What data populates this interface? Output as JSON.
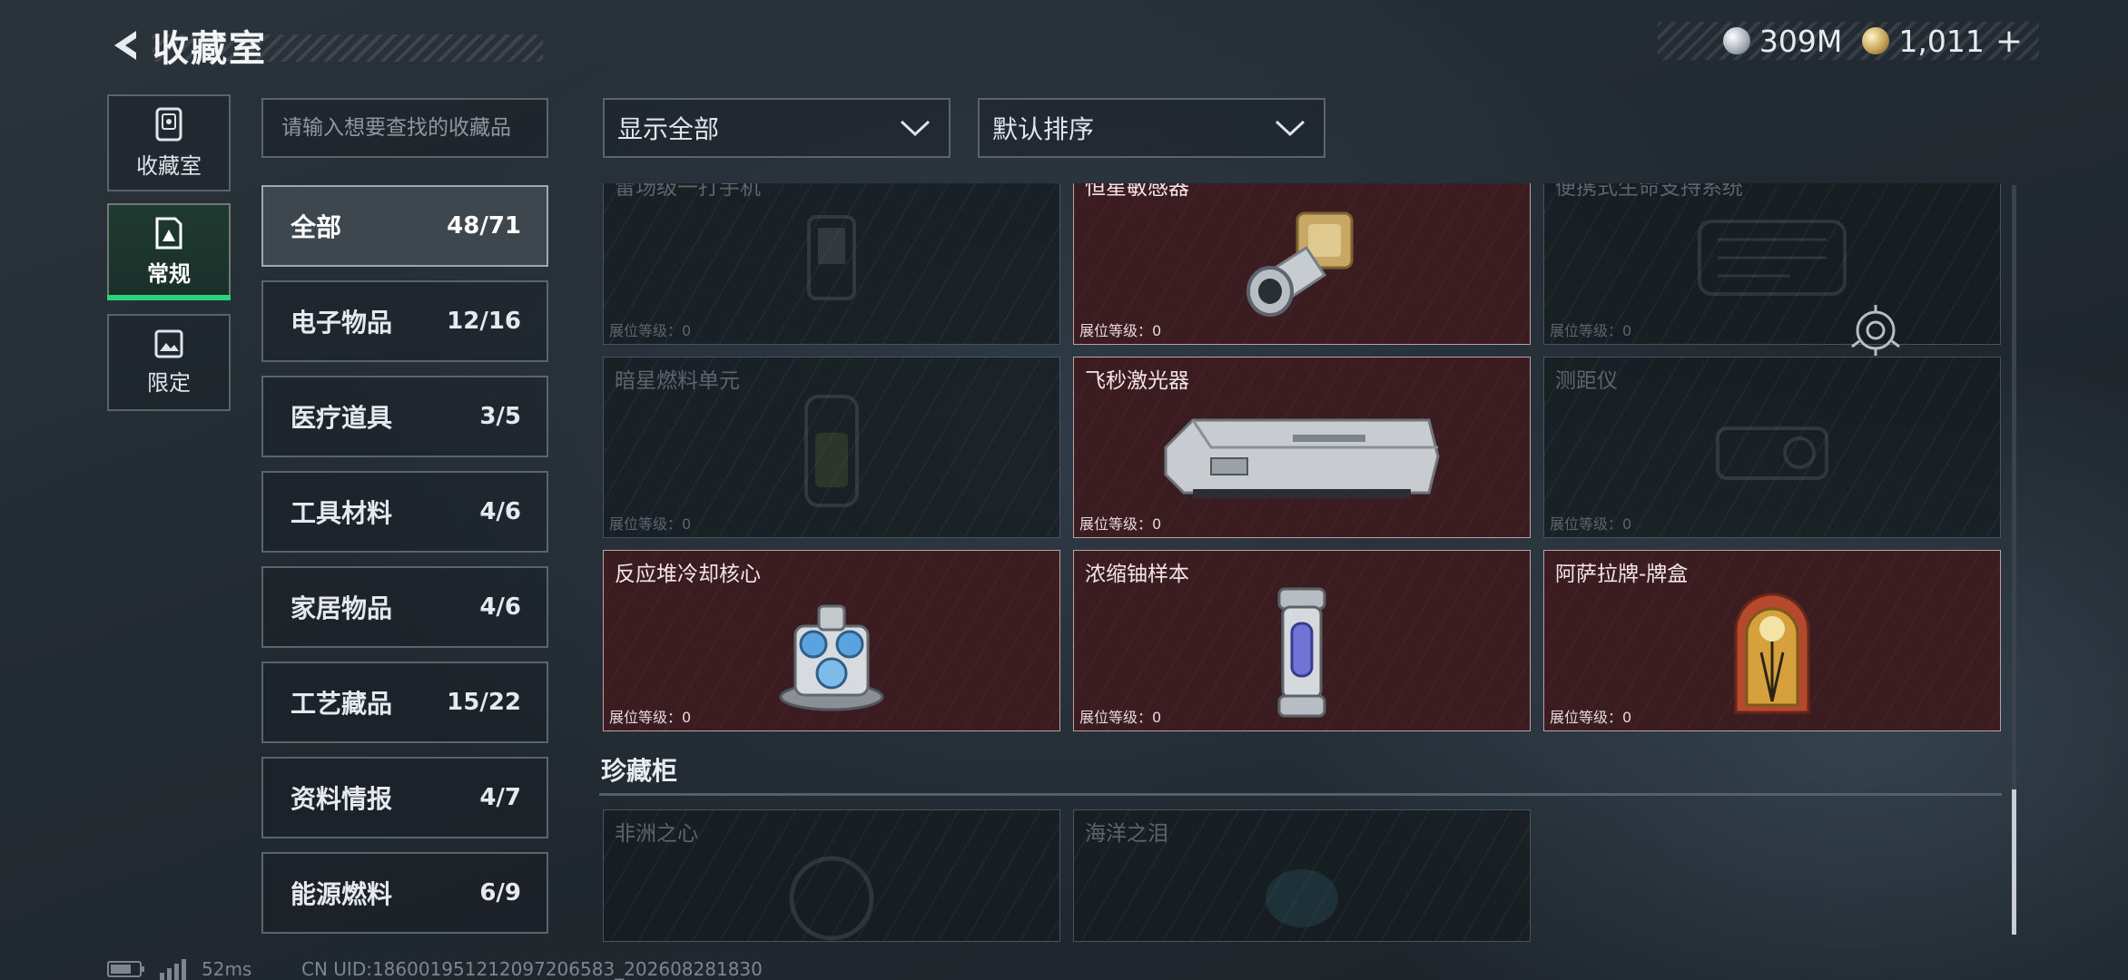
{
  "header": {
    "title": "收藏室"
  },
  "currency": {
    "silver": "309M",
    "gold": "1,011",
    "plus": "+"
  },
  "modes": [
    {
      "label": "收藏室",
      "icon": "vault-icon"
    },
    {
      "label": "常规",
      "icon": "card-icon"
    },
    {
      "label": "限定",
      "icon": "image-icon"
    }
  ],
  "search": {
    "placeholder": "请输入想要查找的收藏品"
  },
  "categories": [
    {
      "name": "全部",
      "count": "48/71"
    },
    {
      "name": "电子物品",
      "count": "12/16"
    },
    {
      "name": "医疗道具",
      "count": "3/5"
    },
    {
      "name": "工具材料",
      "count": "4/6"
    },
    {
      "name": "家居物品",
      "count": "4/6"
    },
    {
      "name": "工艺藏品",
      "count": "15/22"
    },
    {
      "name": "资料情报",
      "count": "4/7"
    },
    {
      "name": "能源燃料",
      "count": "6/9"
    }
  ],
  "filters": {
    "show": "显示全部",
    "sort": "默认排序"
  },
  "level_label": "展位等级：0",
  "items": [
    {
      "name": "雷场级一打手机",
      "owned": false
    },
    {
      "name": "恒星敏感器",
      "owned": true
    },
    {
      "name": "便携式生命支持系统",
      "owned": false
    },
    {
      "name": "暗星燃料单元",
      "owned": false
    },
    {
      "name": "飞秒激光器",
      "owned": true
    },
    {
      "name": "测距仪",
      "owned": false
    },
    {
      "name": "反应堆冷却核心",
      "owned": true
    },
    {
      "name": "浓缩铀样本",
      "owned": true
    },
    {
      "name": "阿萨拉牌-牌盒",
      "owned": true
    }
  ],
  "cabinet": {
    "title": "珍藏柜",
    "items": [
      {
        "name": "非洲之心",
        "owned": false
      },
      {
        "name": "海洋之泪",
        "owned": false
      }
    ]
  },
  "footer": {
    "ping": "52ms",
    "uid": "CN UID:186001951212097206583_202608281830"
  }
}
